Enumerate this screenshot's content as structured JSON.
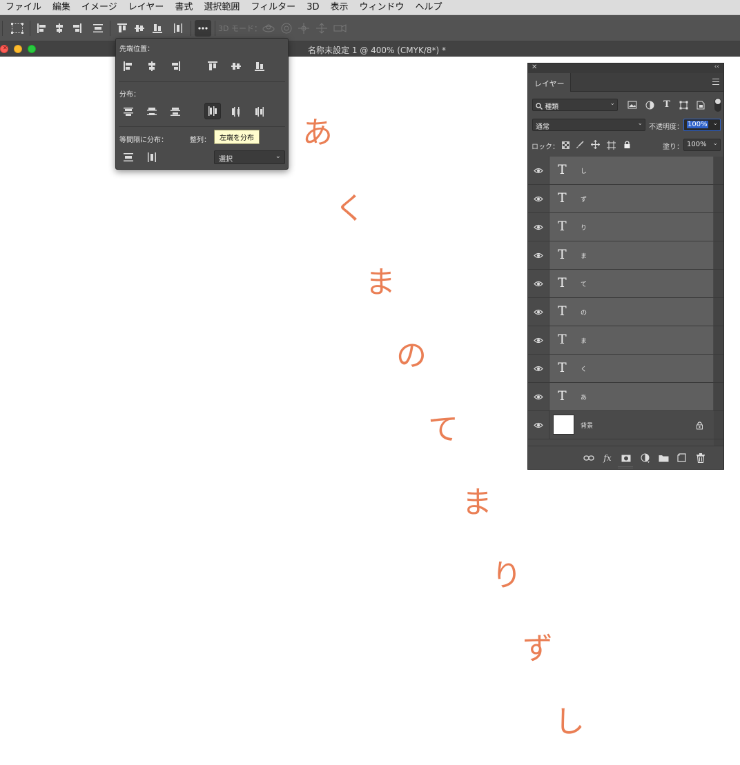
{
  "menubar": {
    "items": [
      "ファイル",
      "編集",
      "イメージ",
      "レイヤー",
      "書式",
      "選択範囲",
      "フィルター",
      "3D",
      "表示",
      "ウィンドウ",
      "ヘルプ"
    ]
  },
  "options_bar": {
    "mode_3d_label": "3D モード："
  },
  "document": {
    "title": "名称未設定 1 @ 400% (CMYK/8*) *"
  },
  "align_popup": {
    "edge_label": "先端位置：",
    "distribute_label": "分布：",
    "spacing_label": "等間隔に分布：",
    "align_to_label": "整列：",
    "tooltip": "左端を分布",
    "align_to_value": "選択"
  },
  "canvas": {
    "text_color": "#ea7f55",
    "letters": [
      "あ",
      "く",
      "ま",
      "の",
      "て",
      "ま",
      "り",
      "ず",
      "し"
    ]
  },
  "layers_panel": {
    "tab_label": "レイヤー",
    "filter_kind": "種類",
    "blend_mode": "通常",
    "opacity_label": "不透明度：",
    "opacity_value": "100%",
    "lock_label": "ロック：",
    "fill_label": "塗り：",
    "fill_value": "100%",
    "layers": [
      {
        "name": "し",
        "type": "text"
      },
      {
        "name": "ず",
        "type": "text"
      },
      {
        "name": "り",
        "type": "text"
      },
      {
        "name": "ま",
        "type": "text"
      },
      {
        "name": "て",
        "type": "text"
      },
      {
        "name": "の",
        "type": "text"
      },
      {
        "name": "ま",
        "type": "text"
      },
      {
        "name": "く",
        "type": "text"
      },
      {
        "name": "あ",
        "type": "text"
      },
      {
        "name": "背景",
        "type": "background"
      }
    ],
    "text_layer_glyph": "T",
    "footer_fx": "fx"
  },
  "colors": {
    "accent_selection": "#2f62c9",
    "panel_bg": "#4a4a4a",
    "tooltip_bg": "#fffdcd"
  }
}
